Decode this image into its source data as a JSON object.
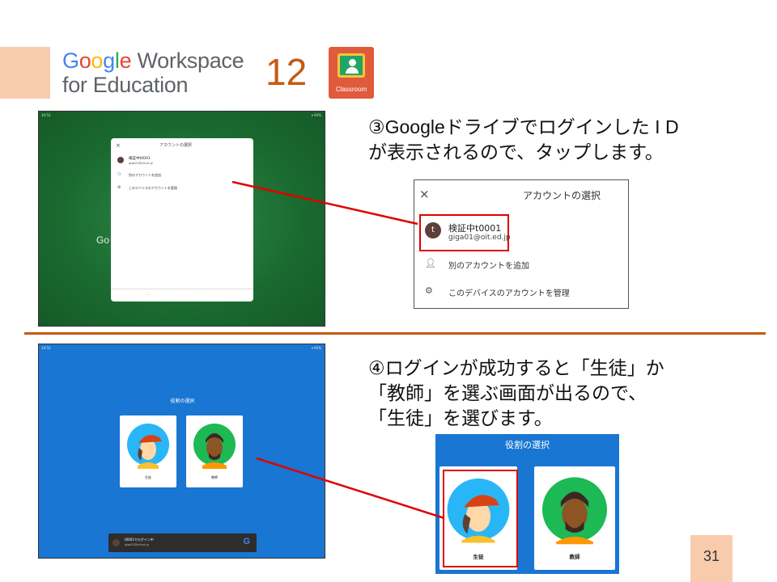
{
  "header": {
    "logo_google": [
      "G",
      "o",
      "o",
      "g",
      "l",
      "e"
    ],
    "logo_workspace": "Workspace",
    "logo_line2": "for Education",
    "section_number": "12",
    "classroom_label": "Classroom"
  },
  "step3": {
    "line1": "③Googleドライブでログインした I D",
    "line2": "が表示されるので、タップします。",
    "dialog": {
      "close": "×",
      "title": "アカウントの選択",
      "account_initial": "t",
      "account_name": "検証中t0001",
      "account_email": "giga01@oit.ed.jp",
      "add_account": "別のアカウントを追加",
      "manage_accounts": "このデバイスのアカウントを管理"
    }
  },
  "step4": {
    "line1": "④ログインが成功すると「生徒」か",
    "line2": "「教師」を選ぶ画面が出るので、",
    "line3": "「生徒」を選びます。",
    "role_screen": {
      "title": "役割の選択",
      "student": "生徒",
      "teacher": "教師"
    }
  },
  "page_number": "31",
  "colors": {
    "accent_orange": "#c55a11",
    "accent_peach": "#f8cbad",
    "highlight_red": "#e00000",
    "screen_green": "#1a6a30",
    "screen_blue": "#1976d2"
  }
}
